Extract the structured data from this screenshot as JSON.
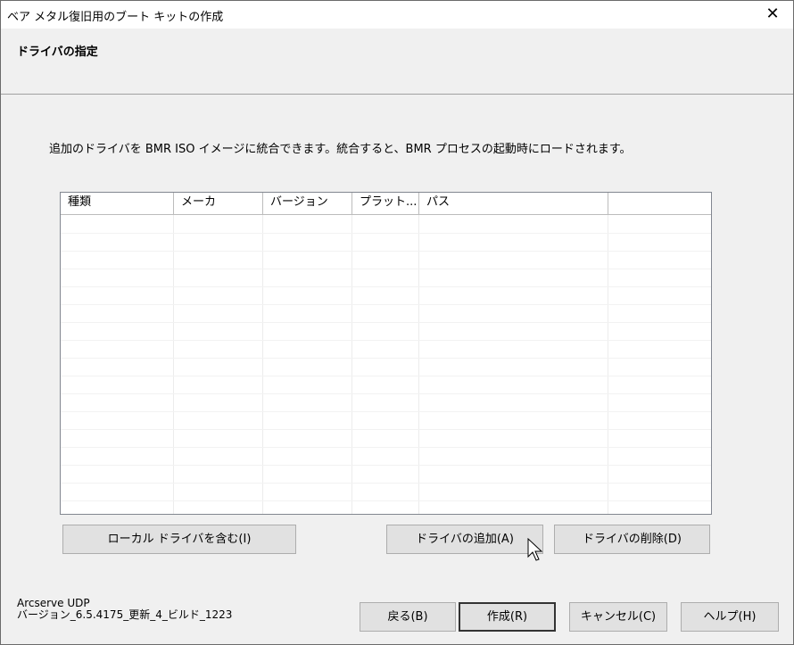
{
  "window": {
    "title": "ベア メタル復旧用のブート キットの作成",
    "close_label": "✕"
  },
  "header": {
    "title": "ドライバの指定"
  },
  "description": "追加のドライバを BMR ISO イメージに統合できます。統合すると、BMR プロセスの起動時にロードされます。",
  "driver_list": {
    "columns": [
      "種類",
      "メーカ",
      "バージョン",
      "プラット...",
      "パス",
      ""
    ],
    "rows": []
  },
  "buttons": {
    "include_local": "ローカル ドライバを含む(I)",
    "add_driver": "ドライバの追加(A)",
    "remove_driver": "ドライバの削除(D)",
    "back": "戻る(B)",
    "create": "作成(R)",
    "cancel": "キャンセル(C)",
    "help": "ヘルプ(H)"
  },
  "footer": {
    "product": "Arcserve UDP",
    "version": "バージョン_6.5.4175_更新_4_ビルド_1223"
  }
}
